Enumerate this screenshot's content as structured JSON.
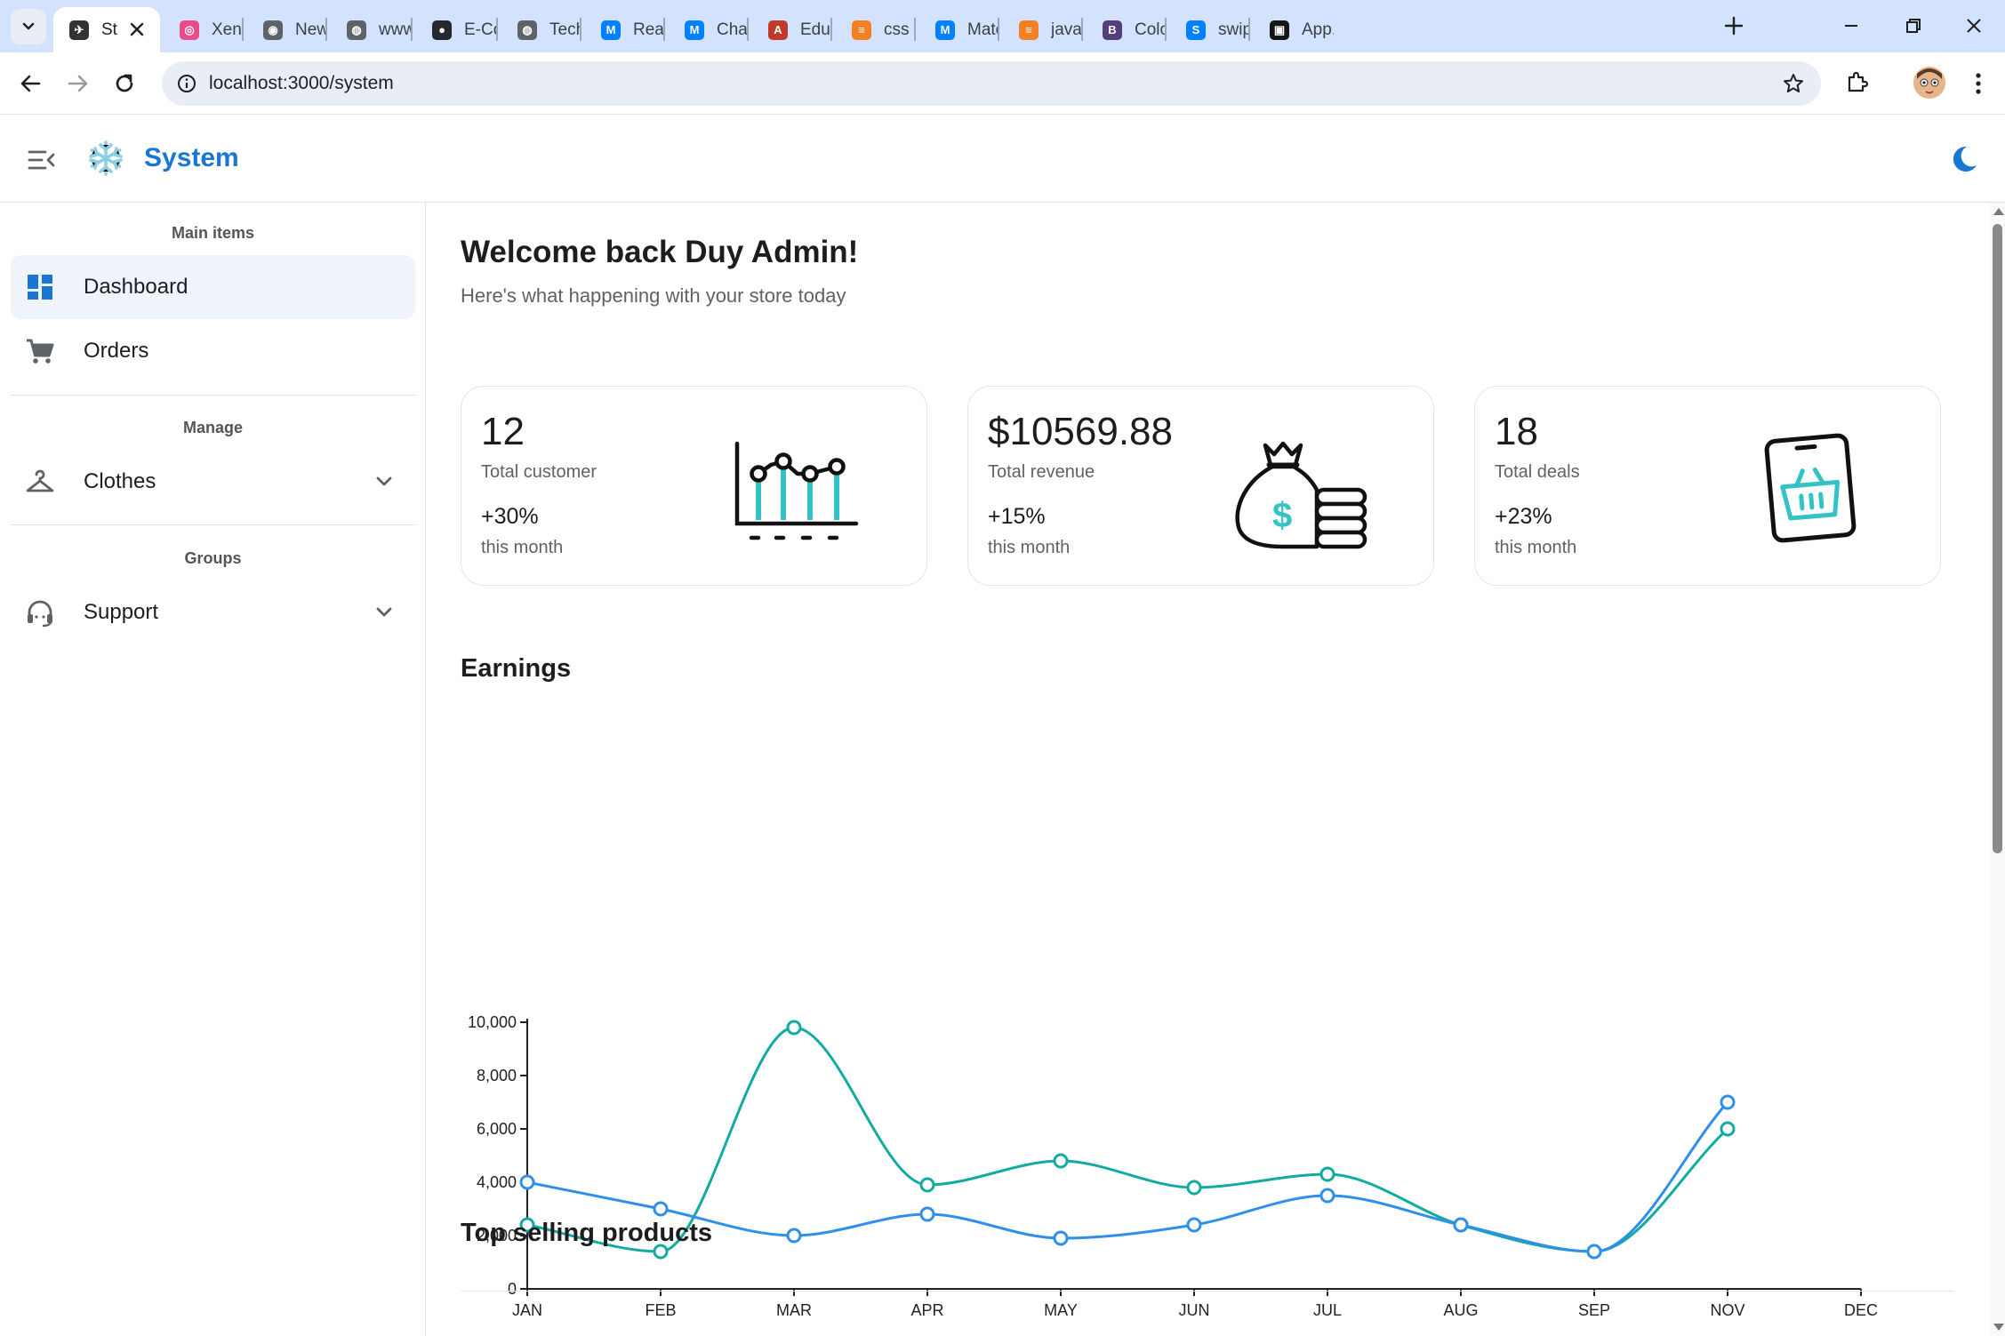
{
  "browser": {
    "tabs": [
      {
        "title": "St",
        "favicon": "app-favicon",
        "color": "#333333",
        "active": true
      },
      {
        "title": "Xenith",
        "favicon": "dribbble-icon",
        "color": "#ea4c89"
      },
      {
        "title": "New Ta",
        "favicon": "chrome-icon",
        "color": "#5f6368"
      },
      {
        "title": "www.m",
        "favicon": "globe-icon",
        "color": "#5f6368"
      },
      {
        "title": "E-Com",
        "favicon": "github-icon",
        "color": "#24292f"
      },
      {
        "title": "Tech st",
        "favicon": "globe-icon",
        "color": "#5f6368"
      },
      {
        "title": "React C",
        "favicon": "mui-icon",
        "color": "#007fff"
      },
      {
        "title": "Charts",
        "favicon": "mui-icon",
        "color": "#007fff"
      },
      {
        "title": "Educat",
        "favicon": "edu-icon",
        "color": "#c0392b"
      },
      {
        "title": "css - sy",
        "favicon": "stackoverflow-icon",
        "color": "#f48024"
      },
      {
        "title": "Materi",
        "favicon": "mui-icon",
        "color": "#007fff"
      },
      {
        "title": "javascr",
        "favicon": "stackoverflow-icon",
        "color": "#f48024"
      },
      {
        "title": "Colors",
        "favicon": "bootstrap-icon",
        "color": "#563d7c"
      },
      {
        "title": "swiper",
        "favicon": "swiper-icon",
        "color": "#0080ff"
      },
      {
        "title": "App.js",
        "favicon": "codesandbox-icon",
        "color": "#151515"
      }
    ],
    "url": "localhost:3000/system"
  },
  "header": {
    "app_title": "System"
  },
  "sidebar": {
    "sections": [
      {
        "subheader": "Main items"
      },
      {
        "subheader": "Manage"
      },
      {
        "subheader": "Groups"
      }
    ],
    "items": [
      {
        "label": "Dashboard",
        "icon": "dashboard-icon",
        "selected": true
      },
      {
        "label": "Orders",
        "icon": "cart-icon"
      },
      {
        "label": "Clothes",
        "icon": "hanger-icon",
        "expandable": true
      },
      {
        "label": "Support",
        "icon": "headset-icon",
        "expandable": true
      }
    ]
  },
  "main": {
    "welcome_title": "Welcome back Duy Admin!",
    "welcome_subtitle": "Here's what happening with your store today",
    "cards": [
      {
        "value": "12",
        "label": "Total customer",
        "change": "+30%",
        "period": "this month",
        "icon": "chart-icon"
      },
      {
        "value": "$10569.88",
        "label": "Total revenue",
        "change": "+15%",
        "period": "this month",
        "icon": "money-bag-icon"
      },
      {
        "value": "18",
        "label": "Total deals",
        "change": "+23%",
        "period": "this month",
        "icon": "tablet-basket-icon"
      }
    ],
    "earnings_title": "Earnings",
    "top_selling_title": "Top selling products"
  },
  "colors": {
    "primary": "#1976d2",
    "teal_series": "#12aba0",
    "blue_series": "#2f8fea",
    "accent_icon": "#33c3c6"
  },
  "chart_data": {
    "type": "line",
    "categories": [
      "JAN",
      "FEB",
      "MAR",
      "APR",
      "MAY",
      "JUN",
      "JUL",
      "AUG",
      "SEP",
      "NOV",
      "DEC"
    ],
    "ylim": [
      0,
      10000
    ],
    "yticks": [
      0,
      2000,
      4000,
      6000,
      8000,
      10000
    ],
    "ytick_labels": [
      "0",
      "2,000",
      "4,000",
      "6,000",
      "8,000",
      "10,000"
    ],
    "series": [
      {
        "values": [
          2400,
          1400,
          9800,
          3900,
          4800,
          3800,
          4300,
          2400,
          1400,
          6000,
          null
        ],
        "color": "#12aba0"
      },
      {
        "values": [
          4000,
          3000,
          2000,
          2800,
          1900,
          2400,
          3500,
          2400,
          1400,
          7000,
          null
        ],
        "color": "#2f8fea"
      }
    ],
    "smooth": true,
    "markers": "hollow-circle",
    "grid": false,
    "legend": "none"
  }
}
